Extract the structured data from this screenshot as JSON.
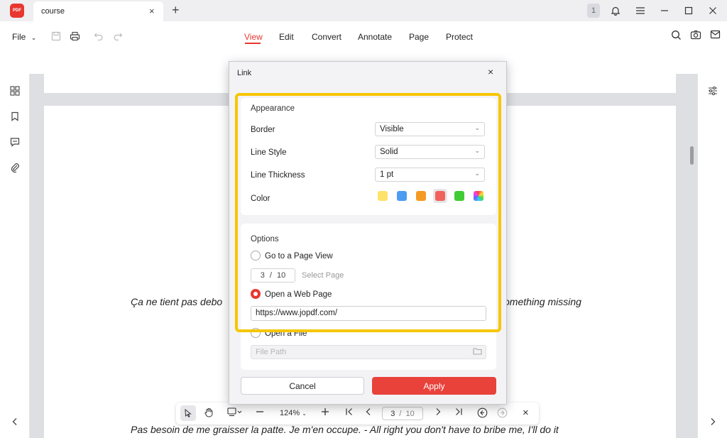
{
  "titlebar": {
    "app_logo_text": "PDF",
    "tab_title": "course",
    "tab_close": "×",
    "tab_add": "+",
    "badge_count": "1",
    "icons": [
      "bell-icon",
      "hamburger-menu-icon",
      "minimize-icon",
      "maximize-icon",
      "close-icon"
    ]
  },
  "toolbar": {
    "file_label": "File",
    "menu": [
      "View",
      "Edit",
      "Convert",
      "Annotate",
      "Page",
      "Protect"
    ],
    "active_menu": "View",
    "right_icons": [
      "search-icon",
      "camera-icon",
      "mail-icon"
    ]
  },
  "document": {
    "line1_left": "Ça ne tient pas debo",
    "line1_right": "omething missing",
    "line2": "Pas besoin de me graisser la patte. Je m'en occupe. - All right you don't have to bribe me, I'll do it"
  },
  "dialog": {
    "title": "Link",
    "close": "×",
    "appearance": {
      "title": "Appearance",
      "border_label": "Border",
      "border_value": "Visible",
      "line_style_label": "Line Style",
      "line_style_value": "Solid",
      "line_thickness_label": "Line Thickness",
      "line_thickness_value": "1 pt",
      "color_label": "Color",
      "colors": [
        "#fde36a",
        "#4c9cf2",
        "#f59a23",
        "#f0625c",
        "#3fcc34"
      ],
      "selected_color": "#f0625c"
    },
    "options": {
      "title": "Options",
      "go_to_page_label": "Go to a Page View",
      "page_current": "3",
      "page_separator": "/",
      "page_total": "10",
      "select_page": "Select Page",
      "open_web_label": "Open a Web Page",
      "url_value": "https://www.jopdf.com/",
      "open_file_label": "Open a File",
      "file_path_placeholder": "File Path",
      "selected": "open_web"
    },
    "cancel_label": "Cancel",
    "apply_label": "Apply"
  },
  "bottom_bar": {
    "zoom": "124%",
    "page_current": "3",
    "page_separator": "/",
    "page_total": "10",
    "close": "×"
  },
  "colors": {
    "accent": "#e8372f",
    "highlight": "#f6c602"
  }
}
